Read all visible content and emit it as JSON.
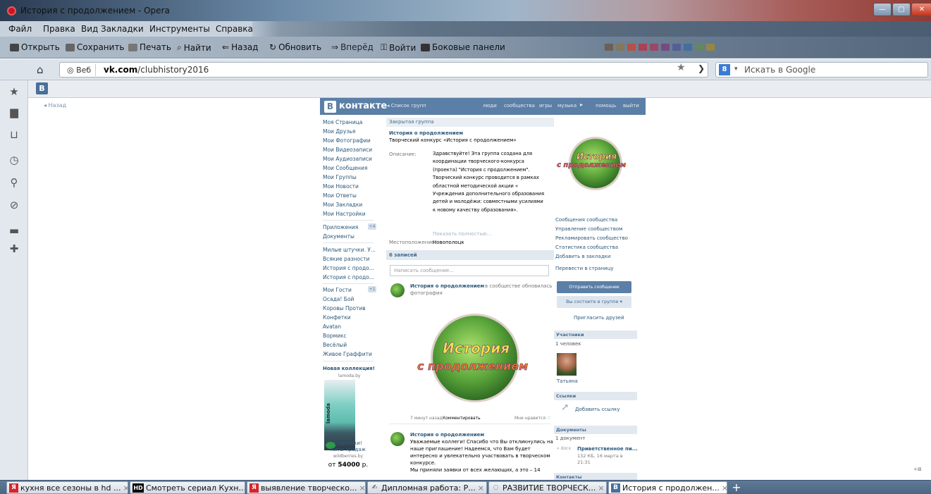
{
  "window": {
    "title": "История с продолжением - Opera",
    "minimize": "—",
    "maximize": "▢",
    "close": "✕"
  },
  "menu": [
    "Файл",
    "Правка",
    "Вид",
    "Закладки",
    "Инструменты",
    "Справка"
  ],
  "toolbar": {
    "open": "Открыть",
    "save": "Сохранить",
    "print": "Печать",
    "find": "Найти",
    "back": "Назад",
    "reload": "Обновить",
    "forward": "Вперёд",
    "login": "Войти",
    "panels": "Боковые панели"
  },
  "address": {
    "badge": "Веб",
    "url_host": "vk.com",
    "url_path": "/clubhistory2016",
    "search_placeholder": "Искать в Google",
    "search_engine": "8"
  },
  "bookmark": {
    "vk": "B"
  },
  "sidepanel_icons": [
    "star-icon",
    "notes-icon",
    "downloads-icon",
    "history-icon",
    "search-icon",
    "links-icon",
    "panels-icon",
    "add-icon"
  ],
  "vk": {
    "back": "◂ Назад",
    "logo": "контакте",
    "logo_b": "B",
    "group_list": "◂ Список групп",
    "nav": [
      "люди",
      "сообщества",
      "игры",
      "музыка",
      "помощь",
      "выйти"
    ],
    "left_menu": [
      "Моя Страница",
      "Мои Друзья",
      "Мои Фотографии",
      "Мои Видеозаписи",
      "Мои Аудиозаписи",
      "Мои Сообщения",
      "Мои Группы",
      "Мои Новости",
      "Мои Ответы",
      "Мои Закладки",
      "Мои Настройки"
    ],
    "apps": {
      "label": "Приложения",
      "badge": "+4",
      "docs": "Документы"
    },
    "apps_list": [
      "Милые штучки. У...",
      "Всякие разности",
      "История с продо...",
      "История с продо..."
    ],
    "guests": {
      "label": "Мои Гости",
      "badge": "+1"
    },
    "guests_list": [
      "Осада! Бой",
      "Коровы Против",
      "Конфетки",
      "Avatan",
      "Вормикс",
      "Весёлый",
      "Живое Граффити"
    ],
    "ad": {
      "title": "Новая коллекция!",
      "domain": "lamoda.by",
      "brand": "lamoda",
      "line1": "Кофточки!",
      "line2": "Хиты продаж",
      "line3": "wildberries.by",
      "price_prefix": "от",
      "price": "54000",
      "price_suffix": "р."
    },
    "main": {
      "closed": "Закрытая группа",
      "group_name": "История о продолжением",
      "group_status": "Творческий конкурс «История с продолжением»",
      "desc_label": "Описание:",
      "desc": "Здравствуйте! Эта группа создана для координации творческого-конкурса (проекта) \"История с продолжением\". Творческий конкурс проводится в рамках областной методической акции « Учреждения дополнительного образования детей и молодёжи: совместными усилиями к новому качеству образования».",
      "show_full": "Показать полностью...",
      "loc_label": "Местоположение:",
      "loc": "Новополоцк",
      "posts_count": "6 записей",
      "write_placeholder": "Написать сообщение...",
      "post1_author": "История о продолжением",
      "post1_text1": "в сообществе обновилась",
      "post1_text2": "фотография",
      "post1_time": "7 минут назад",
      "post1_comment": "Комментировать",
      "post1_like": "Мне нравится ♡",
      "post2_author": "История о продолжением",
      "post2_lines": [
        "Уважаемые коллеги! Спасибо что Вы откликнулись на",
        "наше приглашение! Надеемся, что Вам будет",
        "интересно и увлекательно участвовать в творческом",
        "конкурсе.",
        "Мы приняли заявки от всех желающих, а это – 14"
      ]
    },
    "logo_text_1": "История",
    "logo_text_2": "с продолжением",
    "right": {
      "links": [
        "Сообщения сообщества",
        "Управление сообществом",
        "Рекламировать сообщество",
        "Статистика сообщества",
        "Добавить в закладки"
      ],
      "to_page": "Перевести в страницу",
      "send_msg": "Отправить сообщение",
      "in_group": "Вы состоите в группе ▾",
      "invite": "Пригласить друзей",
      "members_head": "Участники",
      "members_count": "1 человек",
      "member_name": "Татьяна",
      "links_head": "Ссылки",
      "add_link": "Добавить ссылку",
      "docs_head": "Документы",
      "docs_count": "1 документ",
      "doc_badge": "« docx",
      "doc_title": "Приветственное пи...",
      "doc_meta1": "132 КБ, 16 марта в",
      "doc_meta2": "21:31",
      "contacts_head": "Контакты"
    }
  },
  "zoom": "+⊠",
  "tabs": [
    {
      "icon": "Я",
      "label": "кухня все сезоны в hd ...",
      "color": "#d8242a"
    },
    {
      "icon": "HD",
      "label": "Смотреть сериал Кухн...",
      "color": "#000000"
    },
    {
      "icon": "Я",
      "label": "выявление творческо...",
      "color": "#d8242a"
    },
    {
      "icon": "✍",
      "label": "Дипломная работа: Р...",
      "color": "#555555"
    },
    {
      "icon": "◌",
      "label": "РАЗВИТИЕ ТВОРЧЕСК...",
      "color": "#777777"
    },
    {
      "icon": "B",
      "label": "История с продолжен...",
      "color": "#4a6f99"
    }
  ],
  "new_tab": "+",
  "tab_close": "×"
}
